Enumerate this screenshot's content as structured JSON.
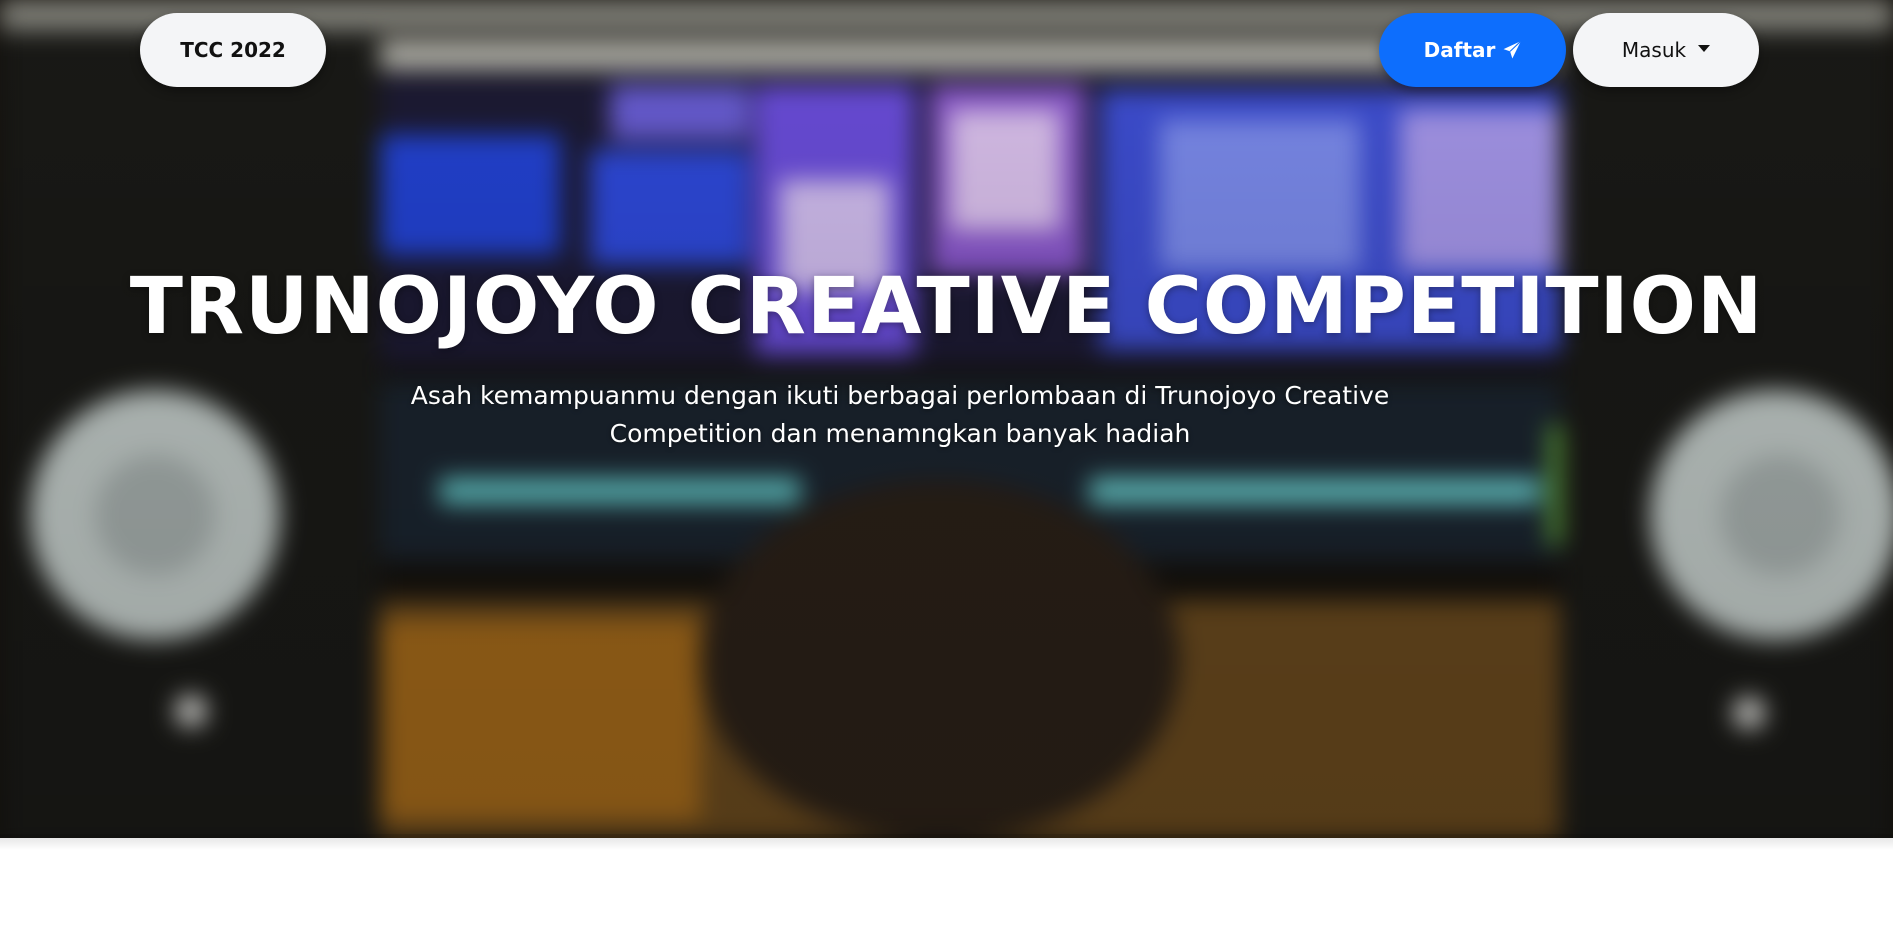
{
  "navbar": {
    "brand": "TCC 2022",
    "register_label": "Daftar",
    "register_icon": "send-icon",
    "login_label": "Masuk",
    "login_icon": "caret-down-icon"
  },
  "hero": {
    "title": "TRUNOJOYO CREATIVE COMPETITION",
    "subtitle_line1": "Asah kemampuanmu dengan ikuti berbagai perlombaan di Trunojoyo Creative",
    "subtitle_line2": "Competition dan menamngkan banyak hadiah"
  },
  "colors": {
    "primary": "#0d6efd",
    "pill_light": "#f4f5f7",
    "text_light": "#ffffff"
  }
}
